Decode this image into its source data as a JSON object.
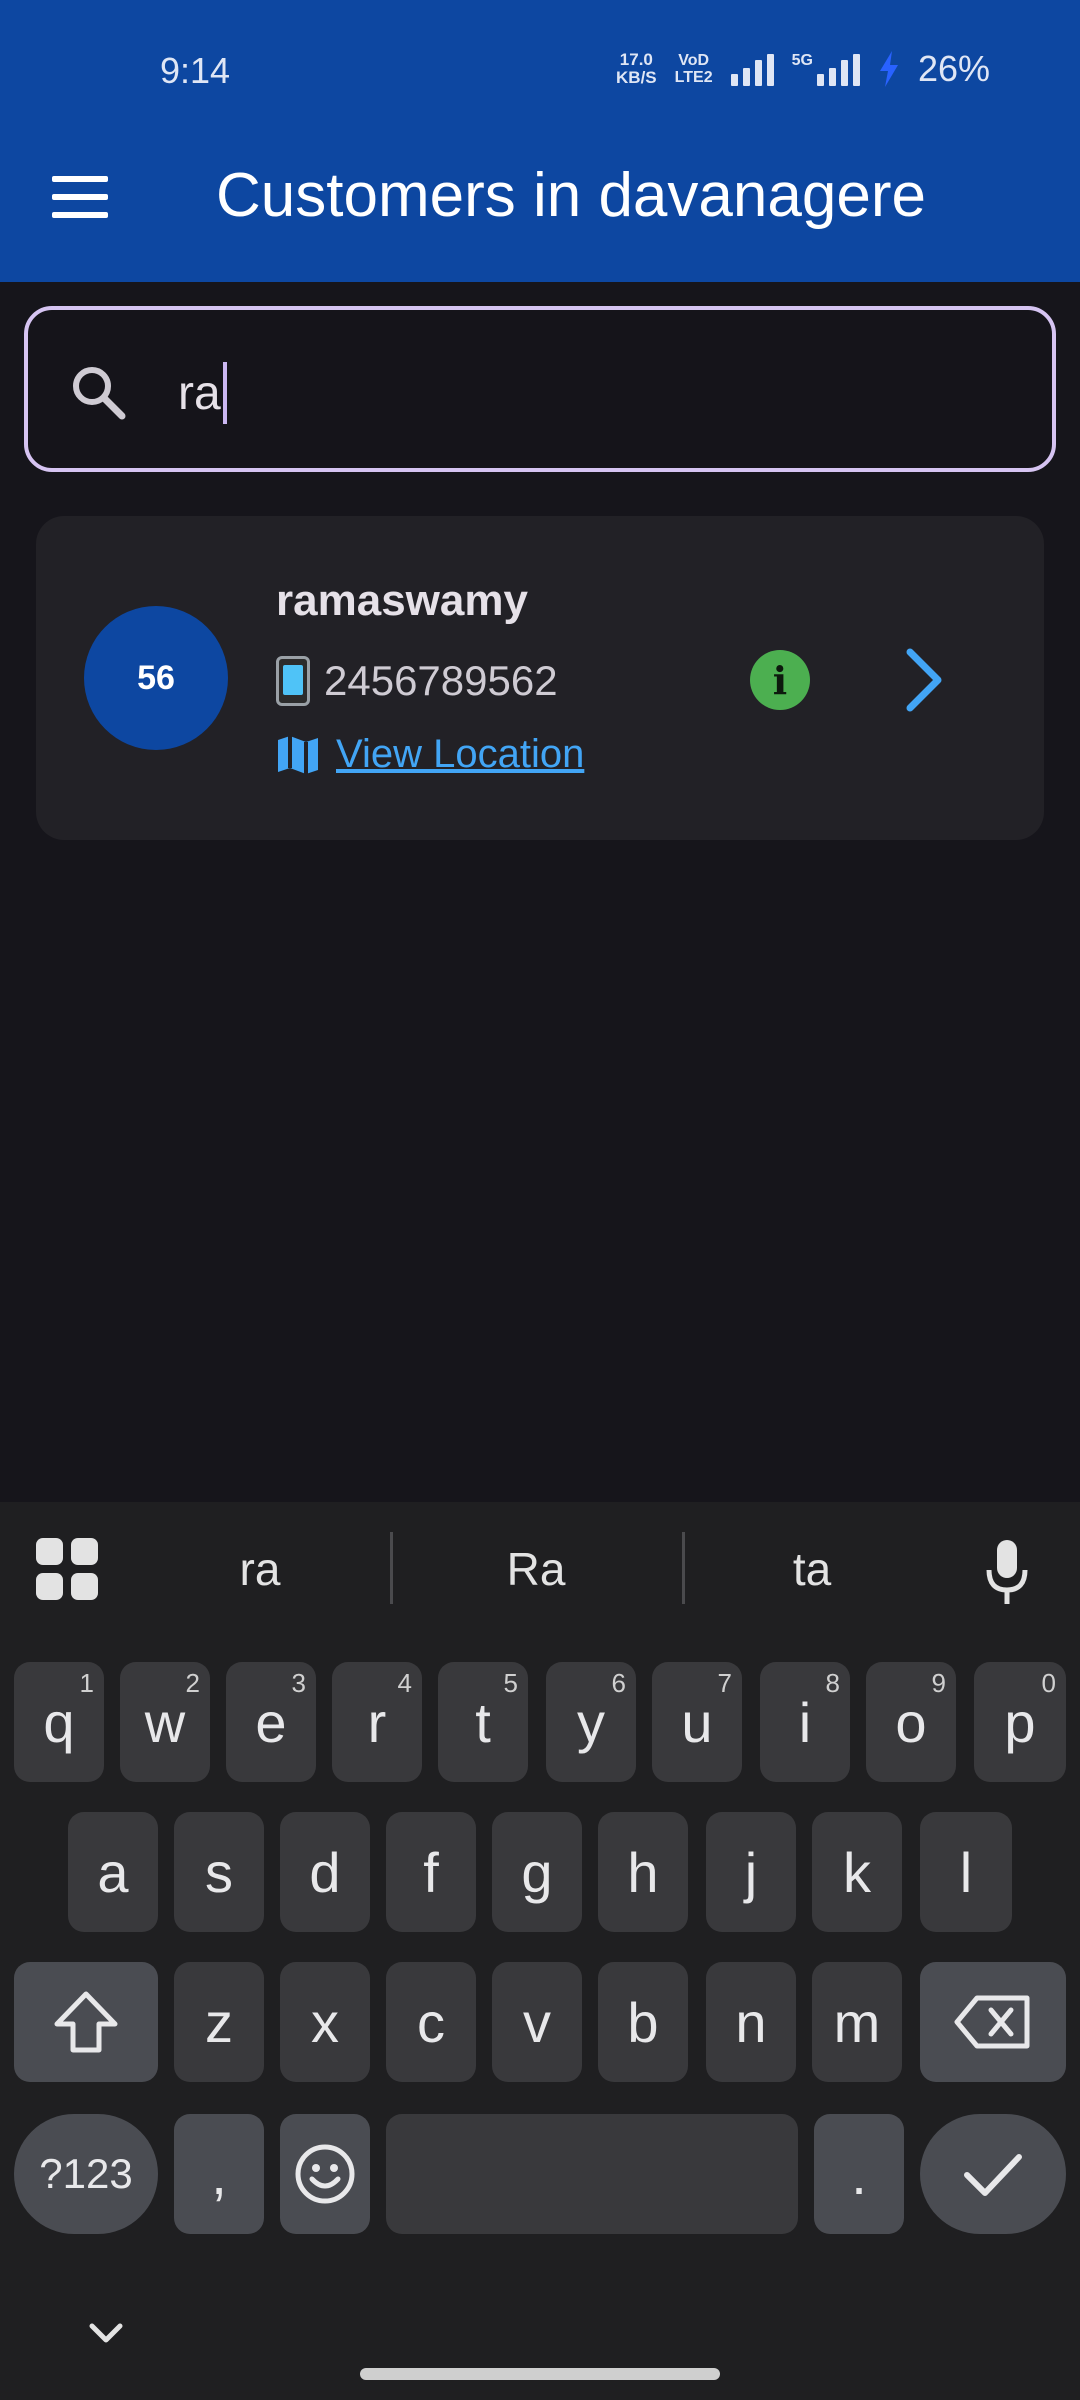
{
  "status": {
    "time": "9:14",
    "net_speed_value": "17.0",
    "net_speed_unit": "KB/S",
    "volte_top": "VoD",
    "volte_bottom": "LTE2",
    "network_5g": "5G",
    "battery": "26%"
  },
  "app_bar": {
    "title": "Customers in davanagere"
  },
  "search": {
    "value": "ra"
  },
  "customers": [
    {
      "avatar_text": "56",
      "name": "ramaswamy",
      "phone": "2456789562",
      "location_link": "View Location"
    }
  ],
  "keyboard": {
    "suggestions": [
      "ra",
      "Ra",
      "ta"
    ],
    "row1": [
      {
        "key": "q",
        "hint": "1"
      },
      {
        "key": "w",
        "hint": "2"
      },
      {
        "key": "e",
        "hint": "3"
      },
      {
        "key": "r",
        "hint": "4"
      },
      {
        "key": "t",
        "hint": "5"
      },
      {
        "key": "y",
        "hint": "6"
      },
      {
        "key": "u",
        "hint": "7"
      },
      {
        "key": "i",
        "hint": "8"
      },
      {
        "key": "o",
        "hint": "9"
      },
      {
        "key": "p",
        "hint": "0"
      }
    ],
    "row2": [
      "a",
      "s",
      "d",
      "f",
      "g",
      "h",
      "j",
      "k",
      "l"
    ],
    "row3": [
      "z",
      "x",
      "c",
      "v",
      "b",
      "n",
      "m"
    ],
    "symbols_label": "?123",
    "comma": ",",
    "period": "."
  },
  "colors": {
    "app_bar": "#0d47a1",
    "background": "#16151b",
    "card": "#222126",
    "search_border": "#d6c4f2",
    "link": "#42a5f5",
    "info": "#4caf50"
  }
}
